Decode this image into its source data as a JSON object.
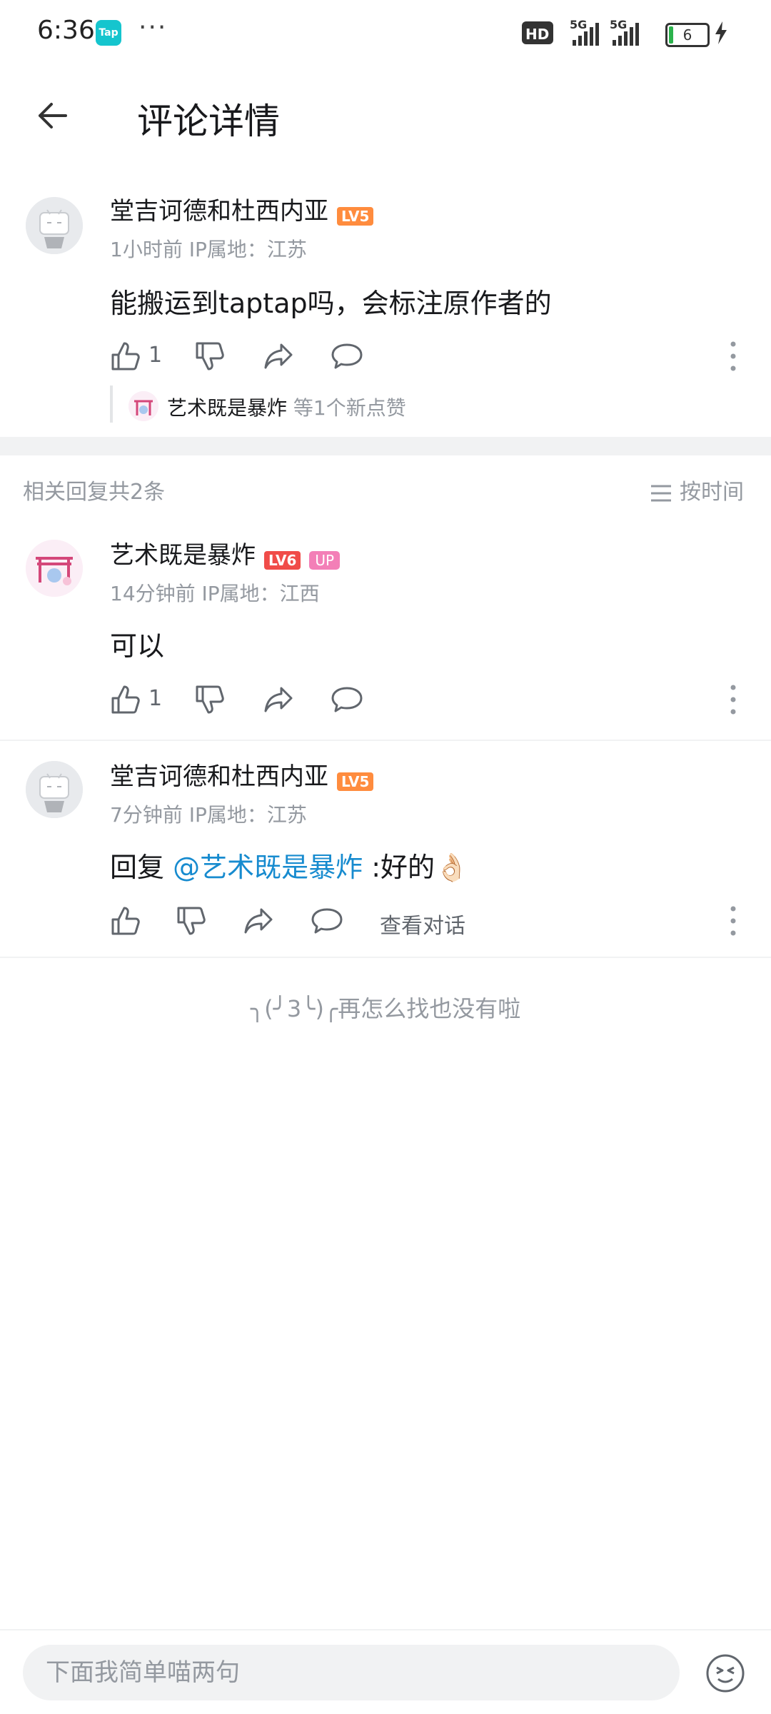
{
  "status_bar": {
    "time": "6:36",
    "app_badge": "Tap",
    "more": "···",
    "network": "HD",
    "sig1": "5G",
    "sig2": "5G",
    "battery": "6"
  },
  "header": {
    "title": "评论详情"
  },
  "main_comment": {
    "user": "堂吉诃德和杜西内亚",
    "level": "LV5",
    "meta": "1小时前 IP属地：江苏",
    "content": "能搬运到taptap吗，会标注原作者的",
    "like_count": "1",
    "liker_name": "艺术既是暴炸",
    "liker_suffix": "等1个新点赞"
  },
  "replies_header": {
    "title": "相关回复共2条",
    "sort_label": "按时间"
  },
  "replies": [
    {
      "user": "艺术既是暴炸",
      "level": "LV6",
      "badge": "UP",
      "meta": "14分钟前 IP属地：江西",
      "content": "可以",
      "like_count": "1"
    },
    {
      "user": "堂吉诃德和杜西内亚",
      "level": "LV5",
      "meta": "7分钟前 IP属地：江苏",
      "content_prefix": "回复 ",
      "mention": "@艺术既是暴炸",
      "content_suffix": " :好的👌🏻",
      "view_conversation": "查看对话"
    }
  ],
  "end_message": "╮(╯3╰)╭再怎么找也没有啦",
  "bottom": {
    "input_placeholder": "下面我简单喵两句"
  },
  "colors": {
    "accent": "#178bcf",
    "lv5": "#ff8c3e",
    "lv6": "#f04c49",
    "up_badge": "#f37fb7"
  }
}
